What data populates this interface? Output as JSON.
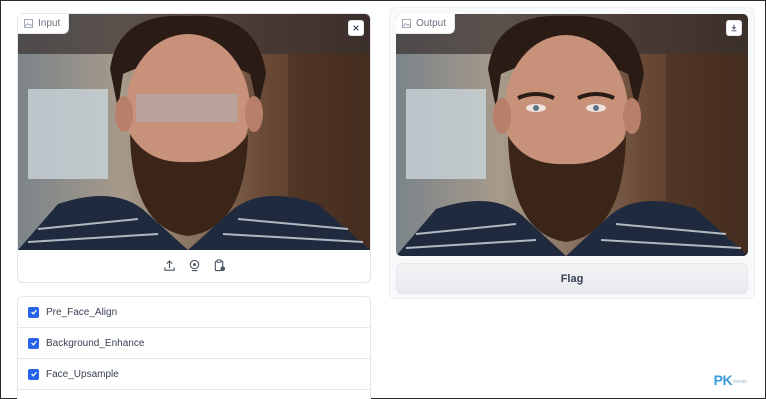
{
  "input": {
    "label": "Input",
    "label_icon": "image-icon",
    "close_icon": "close-icon",
    "source_icons": [
      "upload-icon",
      "webcam-icon",
      "clipboard-icon"
    ]
  },
  "output": {
    "label": "Output",
    "label_icon": "image-icon",
    "download_icon": "download-icon"
  },
  "flag_button": "Flag",
  "options": [
    {
      "label": "Pre_Face_Align",
      "checked": true
    },
    {
      "label": "Background_Enhance",
      "checked": true
    },
    {
      "label": "Face_Upsample",
      "checked": true
    }
  ],
  "watermark": {
    "text": "PK",
    "subtext": "trends"
  },
  "colors": {
    "accent": "#2563eb",
    "watermark": "#3a9bd9"
  }
}
